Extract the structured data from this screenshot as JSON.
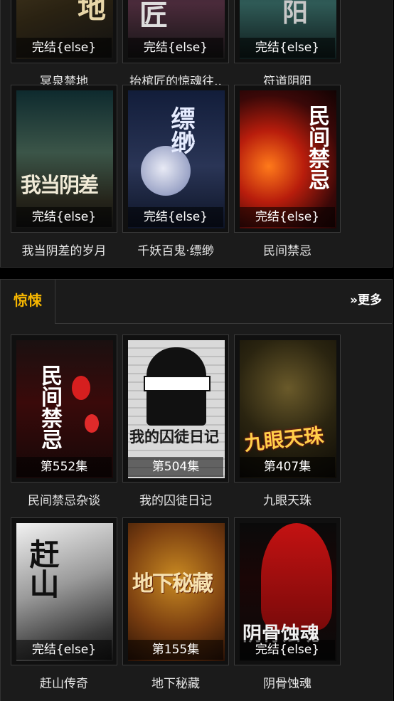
{
  "sections": [
    {
      "books": [
        {
          "title": "冥泉禁地",
          "status": "完结{else}",
          "cover_text": "地"
        },
        {
          "title": "抬棺匠的惊魂往..",
          "status": "完结{else}",
          "cover_text": "匠"
        },
        {
          "title": "符道阴阳",
          "status": "完结{else}",
          "cover_text": "阳"
        },
        {
          "title": "我当阴差的岁月",
          "status": "完结{else}",
          "cover_text": "我当阴差"
        },
        {
          "title": "千妖百鬼·缥缈",
          "status": "完结{else}",
          "cover_text": "缥缈"
        },
        {
          "title": "民间禁忌",
          "status": "完结{else}",
          "cover_text": "民间禁忌"
        }
      ]
    },
    {
      "tab_label": "惊悚",
      "more_label": "»更多",
      "books": [
        {
          "title": "民间禁忌杂谈",
          "status": "第552集",
          "cover_text": "民间禁忌"
        },
        {
          "title": "我的囚徒日记",
          "status": "第504集",
          "cover_text": "我的囚徒日记"
        },
        {
          "title": "九眼天珠",
          "status": "第407集",
          "cover_text": "九眼天珠"
        },
        {
          "title": "赶山传奇",
          "status": "完结{else}",
          "cover_text": "赶山"
        },
        {
          "title": "地下秘藏",
          "status": "第155集",
          "cover_text": "地下秘藏"
        },
        {
          "title": "阴骨蚀魂",
          "status": "完结{else}",
          "cover_text": "阴骨蚀魂"
        }
      ]
    }
  ],
  "colors": {
    "accent": "#f6b600",
    "panel": "#1b1b1b"
  }
}
